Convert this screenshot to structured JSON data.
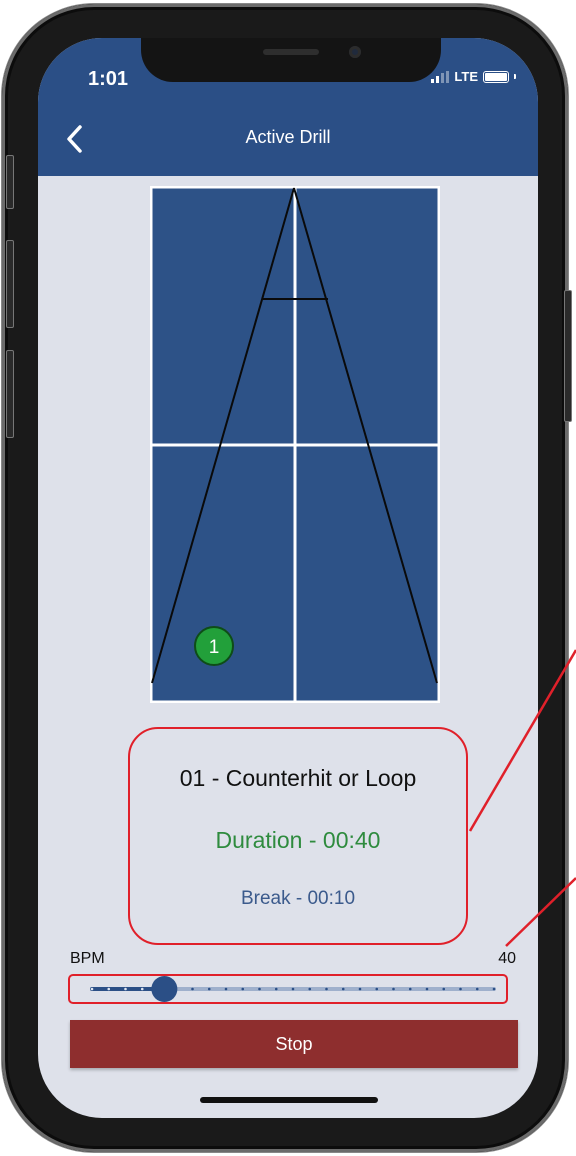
{
  "status_bar": {
    "time": "1:01",
    "network": "LTE"
  },
  "header": {
    "title": "Active Drill",
    "back_icon": "chevron-left-icon"
  },
  "drill": {
    "name": "01 - Counterhit or Loop",
    "duration": "Duration - 00:40",
    "break": "Break - 00:10",
    "ball_number": "1"
  },
  "bpm": {
    "label": "BPM",
    "value": "40",
    "level_fraction": 0.18
  },
  "actions": {
    "stop_label": "Stop"
  },
  "colors": {
    "brand": "#2b4f86",
    "court": "#2d5287",
    "background": "#dee1ea",
    "duration_text": "#2e8b3e",
    "break_text": "#3b5a8c",
    "stop_button": "#8e2e2e",
    "highlight": "#e0202a",
    "ball": "#22a03a"
  }
}
